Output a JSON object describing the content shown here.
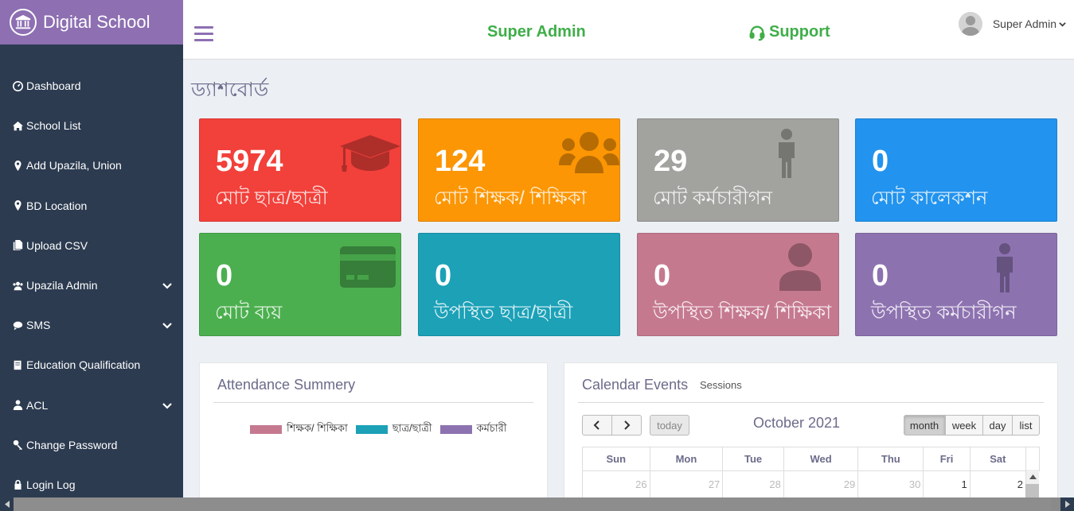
{
  "brand": {
    "name": "Digital School"
  },
  "sidebar": {
    "items": [
      {
        "label": "Dashboard",
        "icon": "dashboard-icon",
        "expandable": false
      },
      {
        "label": "School List",
        "icon": "home-icon",
        "expandable": false
      },
      {
        "label": "Add Upazila, Union",
        "icon": "map-marker-icon",
        "expandable": false
      },
      {
        "label": "BD Location",
        "icon": "map-marker-icon",
        "expandable": false
      },
      {
        "label": "Upload CSV",
        "icon": "files-icon",
        "expandable": false
      },
      {
        "label": "Upazila Admin",
        "icon": "users-icon",
        "expandable": true
      },
      {
        "label": "SMS",
        "icon": "comments-icon",
        "expandable": true
      },
      {
        "label": "Education Qualification",
        "icon": "book-icon",
        "expandable": false
      },
      {
        "label": "ACL",
        "icon": "user-icon",
        "expandable": true
      },
      {
        "label": "Change Password",
        "icon": "key-icon",
        "expandable": false
      },
      {
        "label": "Login Log",
        "icon": "lock-icon",
        "expandable": false
      }
    ]
  },
  "header": {
    "title": "Super Admin",
    "support": "Support",
    "user": "Super Admin"
  },
  "page": {
    "title": "ড্যাশবোর্ড"
  },
  "cards": [
    {
      "value": "5974",
      "label": "মোট ছাত্র/ছাত্রী",
      "color": "#f2403a",
      "icon": "graduation-cap-icon"
    },
    {
      "value": "124",
      "label": "মোট শিক্ষক/ শিক্ষিকা",
      "color": "#fc9604",
      "icon": "users-icon"
    },
    {
      "value": "29",
      "label": "মোট কর্মচারীগন",
      "color": "#a2a29f",
      "icon": "male-icon"
    },
    {
      "value": "0",
      "label": "মোট কালেকশন",
      "color": "#2293ee",
      "icon": ""
    },
    {
      "value": "0",
      "label": "মোট ব্যয়",
      "color": "#4caf4f",
      "icon": "credit-card-icon"
    },
    {
      "value": "0",
      "label": "উপস্থিত ছাত্র/ছাত্রী",
      "color": "#1ca1b7",
      "icon": ""
    },
    {
      "value": "0",
      "label": "উপস্থিত শিক্ষক/ শিক্ষিকা",
      "color": "#c5798f",
      "icon": "user-icon"
    },
    {
      "value": "0",
      "label": "উপস্থিত কর্মচারীগন",
      "color": "#8d72b0",
      "icon": "male-icon"
    }
  ],
  "attendance": {
    "title": "Attendance Summery",
    "legend": [
      {
        "label": "শিক্ষক/ শিক্ষিকা",
        "color": "#c5798f"
      },
      {
        "label": "ছাত্র/ছাত্রী",
        "color": "#1ca1b7"
      },
      {
        "label": "কর্মচারী",
        "color": "#8d72b0"
      }
    ]
  },
  "calendar": {
    "title": "Calendar Events",
    "subtitle": "Sessions",
    "today_label": "today",
    "month_title": "October 2021",
    "views": [
      "month",
      "week",
      "day",
      "list"
    ],
    "active_view": "month",
    "weekdays": [
      "Sun",
      "Mon",
      "Tue",
      "Wed",
      "Thu",
      "Fri",
      "Sat"
    ],
    "first_row": [
      {
        "day": "26",
        "current": false
      },
      {
        "day": "27",
        "current": false
      },
      {
        "day": "28",
        "current": false
      },
      {
        "day": "29",
        "current": false
      },
      {
        "day": "30",
        "current": false
      },
      {
        "day": "1",
        "current": true
      },
      {
        "day": "2",
        "current": true
      }
    ]
  }
}
